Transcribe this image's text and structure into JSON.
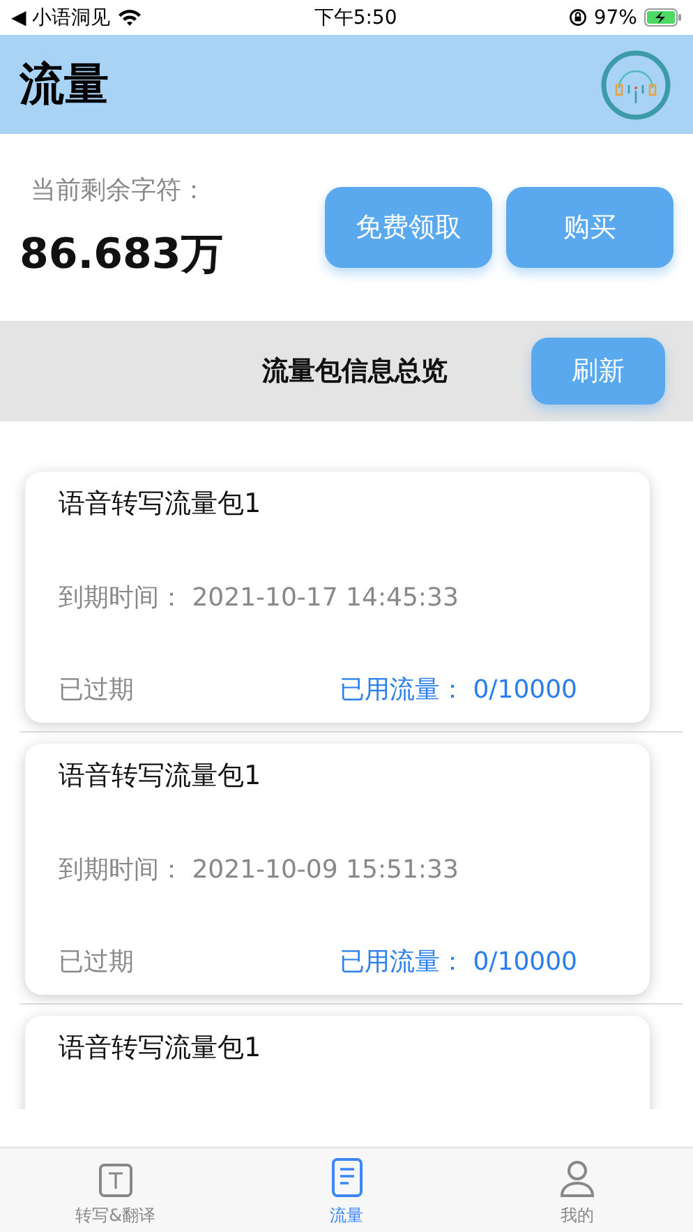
{
  "status_bar": {
    "back_app": "◀ 小语洞见",
    "time": "下午5:50",
    "battery": "97%"
  },
  "header": {
    "title": "流量"
  },
  "balance": {
    "label": "当前剩余字符：",
    "value": "86.683万",
    "buttons": [
      "免费领取",
      "购买"
    ]
  },
  "overview": {
    "title": "流量包信息总览",
    "refresh": "刷新"
  },
  "packages": [
    {
      "name": "语音转写流量包1",
      "expiry": "到期时间：  2021-10-17 14:45:33",
      "status": "已过期",
      "usage": "已用流量：  0/10000"
    },
    {
      "name": "语音转写流量包1",
      "expiry": "到期时间：  2021-10-09 15:51:33",
      "status": "已过期",
      "usage": "已用流量：  0/10000"
    },
    {
      "name": "语音转写流量包1"
    }
  ],
  "tab_bar": [
    {
      "label": "转写&翻译",
      "kind": "text",
      "selected": false
    },
    {
      "label": "流量",
      "kind": "doc",
      "selected": true
    },
    {
      "label": "我的",
      "kind": "person",
      "selected": false
    }
  ]
}
